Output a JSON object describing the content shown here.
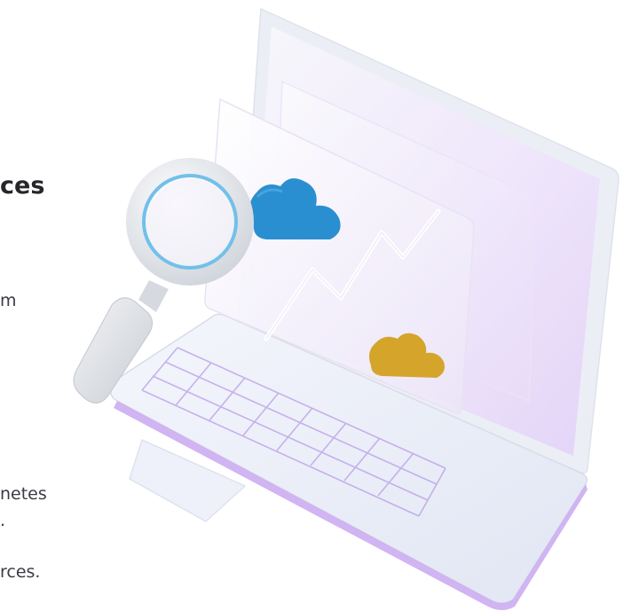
{
  "text_fragments": {
    "heading_tail": "ces",
    "line_1_tail": "m",
    "line_2_tail": "netes",
    "line_3_tail": ".",
    "line_4_tail": "rces."
  },
  "illustration": {
    "icons": [
      "laptop-icon",
      "magnifying-glass-icon",
      "cloud-icon",
      "trend-line-icon"
    ],
    "colors": {
      "laptop_body": "#eef1fa",
      "screen_glow": "#e6d8f6",
      "accent_purple": "#a77be0",
      "cloud_blue": "#2a8fd0",
      "cloud_gold": "#d4a52a",
      "magnifier_ring": "#e9ecef",
      "magnifier_blue": "#72c0ea"
    }
  }
}
